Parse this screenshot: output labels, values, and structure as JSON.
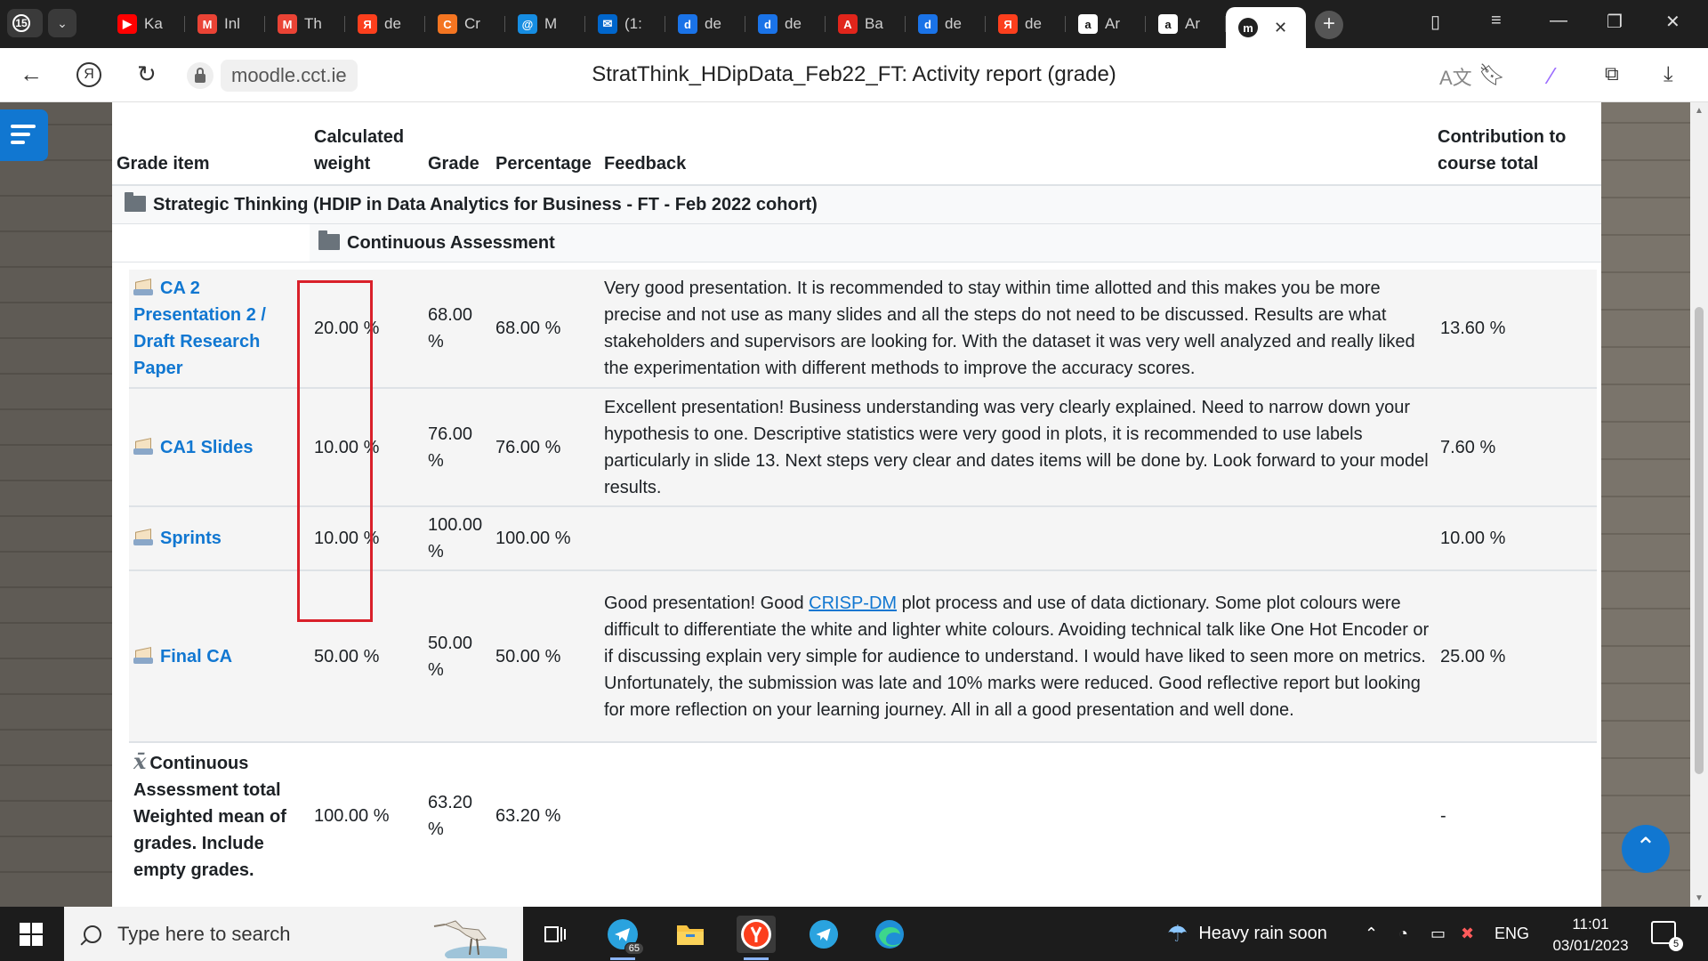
{
  "browser": {
    "tab_count": "15",
    "tabs": [
      {
        "label": "Ka",
        "icon": "youtube-icon",
        "color": "#ff0000",
        "glyph": "▶"
      },
      {
        "label": "Inl",
        "icon": "gmail-icon",
        "color": "#ea4335",
        "glyph": "M"
      },
      {
        "label": "Th",
        "icon": "gmail-icon",
        "color": "#ea4335",
        "glyph": "M"
      },
      {
        "label": "de",
        "icon": "yandex-icon",
        "color": "#fc3f1d",
        "glyph": "Я"
      },
      {
        "label": "Cr",
        "icon": "crunchyroll-icon",
        "color": "#f47521",
        "glyph": "C"
      },
      {
        "label": "M",
        "icon": "mail-at-icon",
        "color": "#168de2",
        "glyph": "@"
      },
      {
        "label": "(1:",
        "icon": "mail-envelope-icon",
        "color": "#0066cc",
        "glyph": "✉"
      },
      {
        "label": "de",
        "icon": "docs-icon",
        "color": "#1a73e8",
        "glyph": "d"
      },
      {
        "label": "de",
        "icon": "docs-icon",
        "color": "#1a73e8",
        "glyph": "d"
      },
      {
        "label": "Ba",
        "icon": "acrobat-icon",
        "color": "#e1251b",
        "glyph": "A"
      },
      {
        "label": "de",
        "icon": "docs-icon",
        "color": "#1a73e8",
        "glyph": "d"
      },
      {
        "label": "de",
        "icon": "yandex-icon",
        "color": "#fc3f1d",
        "glyph": "Я"
      },
      {
        "label": "Ar",
        "icon": "amazon-icon",
        "color": "#ffffff",
        "glyph": "a"
      },
      {
        "label": "Ar",
        "icon": "amazon-icon",
        "color": "#ffffff",
        "glyph": "a"
      }
    ],
    "active_tab": {
      "icon": "moodle-icon",
      "glyph": "m",
      "close": "✕"
    },
    "url": "moodle.cct.ie",
    "page_title": "StratThink_HDipData_Feb22_FT: Activity report (grade)"
  },
  "grade_table": {
    "headers": {
      "item": "Grade item",
      "weight": "Calculated weight",
      "grade": "Grade",
      "percentage": "Percentage",
      "feedback": "Feedback",
      "contribution": "Contribution to course total"
    },
    "course_category": "Strategic Thinking (HDIP in Data Analytics for Business - FT - Feb 2022 cohort)",
    "sub_category": "Continuous Assessment",
    "items": [
      {
        "name": "CA 2 Presentation 2 / Draft Research Paper",
        "weight": "20.00 %",
        "grade": "68.00 %",
        "percentage": "68.00 %",
        "feedback": "Very good presentation. It is recommended to stay within time allotted and this makes you be more precise and not use as many slides and all the steps do not need to be discussed. Results are what stakeholders and supervisors are looking for. With the dataset it was very well analyzed and really liked the experimentation with different methods to improve the accuracy scores.",
        "contribution": "13.60 %"
      },
      {
        "name": "CA1 Slides",
        "weight": "10.00 %",
        "grade": "76.00 %",
        "percentage": "76.00 %",
        "feedback": "Excellent presentation! Business understanding was very clearly explained. Need to narrow down your hypothesis to one. Descriptive statistics were very good in plots, it is recommended to use labels particularly in slide 13. Next steps very clear and dates items will be done by. Look forward to your model results.",
        "contribution": "7.60 %"
      },
      {
        "name": "Sprints",
        "weight": "10.00 %",
        "grade": "100.00 %",
        "percentage": "100.00 %",
        "feedback": "",
        "contribution": "10.00 %"
      },
      {
        "name": "Final CA",
        "weight": "50.00 %",
        "grade": "50.00 %",
        "percentage": "50.00 %",
        "feedback_pre": "Good presentation! Good ",
        "feedback_link": "CRISP-DM",
        "feedback_post": " plot process and use of data dictionary. Some plot colours were difficult to differentiate the white and lighter white colours. Avoiding technical talk like One Hot Encoder or if discussing explain very simple for audience to understand. I would have liked to seen more on metrics. Unfortunately, the submission was late and 10% marks were reduced. Good reflective report but looking for more reflection on your learning journey. All in all a good presentation and well done.",
        "contribution": "25.00 %"
      }
    ],
    "total": {
      "name": "Continuous Assessment total",
      "sub": "Weighted mean of grades. Include empty grades.",
      "weight": "100.00 %",
      "grade": "63.20 %",
      "percentage": "63.20 %",
      "contribution": "-"
    },
    "highlight_color": "#d9202a"
  },
  "taskbar": {
    "search_placeholder": "Type here to search",
    "telegram_badge": "65",
    "weather": "Heavy rain soon",
    "language": "ENG",
    "time": "11:01",
    "date": "03/01/2023",
    "notification_count": "5"
  }
}
